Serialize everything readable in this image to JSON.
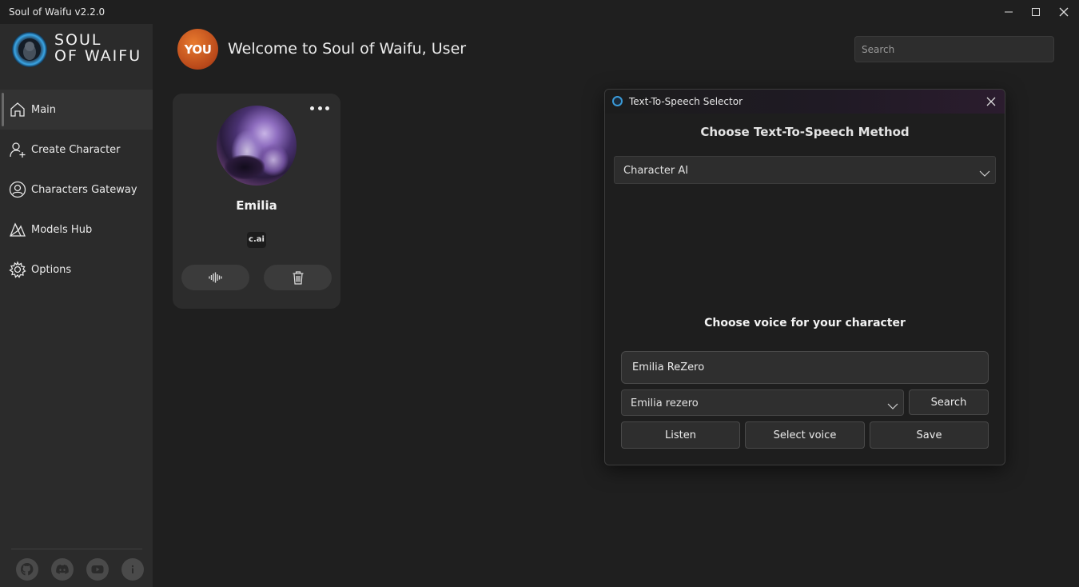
{
  "window": {
    "title": "Soul of Waifu v2.2.0"
  },
  "sidebar": {
    "logo_text_line1": "SOUL",
    "logo_text_line2": "OF WAIFU",
    "items": [
      {
        "label": "Main",
        "icon": "home-icon"
      },
      {
        "label": "Create Character",
        "icon": "add-user-icon"
      },
      {
        "label": "Characters Gateway",
        "icon": "characters-gateway-icon"
      },
      {
        "label": "Models Hub",
        "icon": "models-hub-icon"
      },
      {
        "label": "Options",
        "icon": "settings-icon"
      }
    ],
    "footer_icons": [
      "github-icon",
      "discord-icon",
      "youtube-icon",
      "info-icon"
    ]
  },
  "header": {
    "avatar_text": "YOU",
    "welcome": "Welcome to Soul of Waifu, User",
    "search_placeholder": "Search"
  },
  "character_card": {
    "name": "Emilia",
    "badge": "c.ai"
  },
  "dialog": {
    "title": "Text-To-Speech Selector",
    "heading": "Choose Text-To-Speech Method",
    "method_value": "Character AI",
    "voice_heading": "Choose voice for your character",
    "voice_query": "Emilia ReZero",
    "voice_select_value": "Emilia rezero",
    "search_label": "Search",
    "listen_label": "Listen",
    "select_voice_label": "Select voice",
    "save_label": "Save"
  },
  "colors": {
    "background": "#1f1f1f",
    "sidebar": "#2b2b2b",
    "card": "#2c2c2c",
    "avatar_orange": "#d0622a",
    "dialog_icon": "#3a9ad8"
  }
}
